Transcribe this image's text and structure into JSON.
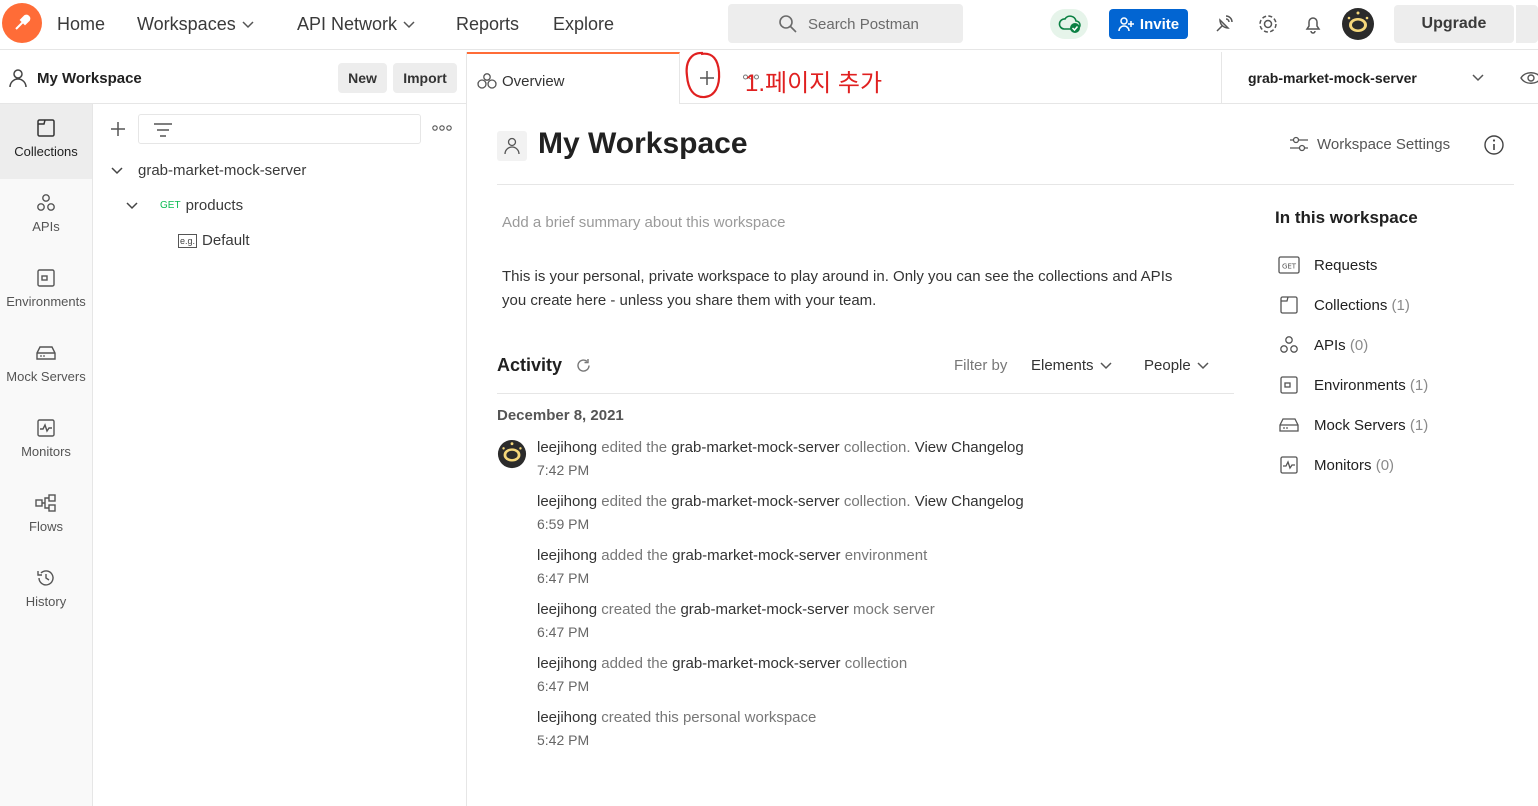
{
  "nav": {
    "home": "Home",
    "workspaces": "Workspaces",
    "api_network": "API Network",
    "reports": "Reports",
    "explore": "Explore",
    "search_placeholder": "Search Postman",
    "invite": "Invite",
    "upgrade": "Upgrade"
  },
  "sidebar": {
    "workspace_name": "My Workspace",
    "new_label": "New",
    "import_label": "Import",
    "items": [
      {
        "label": "Collections",
        "icon": "collections-icon"
      },
      {
        "label": "APIs",
        "icon": "apis-icon"
      },
      {
        "label": "Environments",
        "icon": "environments-icon"
      },
      {
        "label": "Mock Servers",
        "icon": "mock-servers-icon"
      },
      {
        "label": "Monitors",
        "icon": "monitors-icon"
      },
      {
        "label": "Flows",
        "icon": "flows-icon"
      },
      {
        "label": "History",
        "icon": "history-icon"
      }
    ],
    "tree": {
      "collection": "grab-market-mock-server",
      "folder_method": "GET",
      "folder": "products",
      "example_badge": "e.g.",
      "example": "Default"
    }
  },
  "tabs": {
    "overview": "Overview",
    "annotation": "1.페이지 추가",
    "environment": "grab-market-mock-server"
  },
  "main": {
    "title": "My Workspace",
    "settings": "Workspace Settings",
    "summary_placeholder": "Add a brief summary about this workspace",
    "description_line1": "This is your personal, private workspace to play around in. Only you can see the collections and APIs",
    "description_line2": "you create here - unless you share them with your team.",
    "activity": {
      "title": "Activity",
      "filter_by": "Filter by",
      "elements": "Elements",
      "people": "People",
      "date": "December 8, 2021",
      "entries": [
        {
          "user": "leejihong",
          "verb": "edited the",
          "target": "grab-market-mock-server",
          "noun": "collection.",
          "link": "View Changelog",
          "time": "7:42 PM"
        },
        {
          "user": "leejihong",
          "verb": "edited the",
          "target": "grab-market-mock-server",
          "noun": "collection.",
          "link": "View Changelog",
          "time": "6:59 PM"
        },
        {
          "user": "leejihong",
          "verb": "added the",
          "target": "grab-market-mock-server",
          "noun": "environment",
          "link": "",
          "time": "6:47 PM"
        },
        {
          "user": "leejihong",
          "verb": "created the",
          "target": "grab-market-mock-server",
          "noun": "mock server",
          "link": "",
          "time": "6:47 PM"
        },
        {
          "user": "leejihong",
          "verb": "added the",
          "target": "grab-market-mock-server",
          "noun": "collection",
          "link": "",
          "time": "6:47 PM"
        },
        {
          "user": "leejihong",
          "verb": "created this personal workspace",
          "target": "",
          "noun": "",
          "link": "",
          "time": "5:42 PM"
        }
      ]
    }
  },
  "in_workspace": {
    "title": "In this workspace",
    "items": [
      {
        "label": "Requests",
        "count": ""
      },
      {
        "label": "Collections",
        "count": "(1)"
      },
      {
        "label": "APIs",
        "count": "(0)"
      },
      {
        "label": "Environments",
        "count": "(1)"
      },
      {
        "label": "Mock Servers",
        "count": "(1)"
      },
      {
        "label": "Monitors",
        "count": "(0)"
      }
    ]
  },
  "colors": {
    "brand": "#ff6c37",
    "invite": "#0265d2",
    "annotation": "#e02020"
  }
}
